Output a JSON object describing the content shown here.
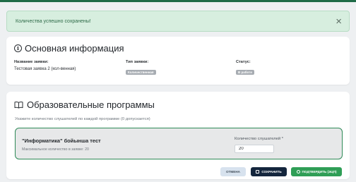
{
  "alert": {
    "message": "Количества успешно сохранены!",
    "close_icon": "×"
  },
  "info_card": {
    "title": "Основная информация",
    "icon": "info-icon",
    "request_name": {
      "label": "Название заявки:",
      "value": "Тестовая заявка 2 (кол-венная)"
    },
    "request_type": {
      "label": "Тип заявки:",
      "badge": "Количественная"
    },
    "status": {
      "label": "Статус:",
      "badge": "В работе"
    }
  },
  "programs_card": {
    "title": "Образовательные программы",
    "icon": "book-icon",
    "hint": "Укажите количество слушателей по каждой программе (0 допускается)",
    "program": {
      "name": "\"Информатика\" бойынша тест",
      "max_text": "Максимальное количество в заявке: 20",
      "quantity_label": "Количество слушателей *",
      "quantity_value": "20"
    }
  },
  "actions": {
    "cancel": "ОТМЕНА",
    "save": "СОХРАНИТЬ",
    "submit": "ПОДТВЕРДИТЬ (ЭЦП)"
  },
  "colors": {
    "accent_green": "#2f9e56",
    "dark_navy": "#14263d",
    "alert_bg": "#d7eedf"
  }
}
